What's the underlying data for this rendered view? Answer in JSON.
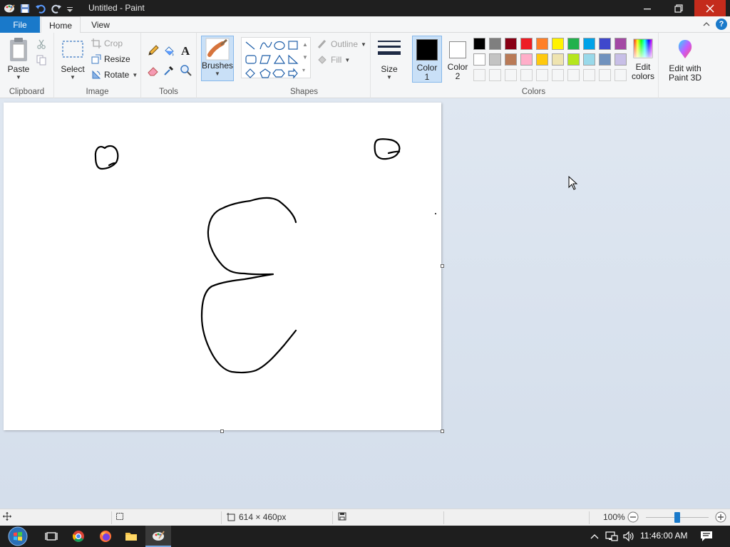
{
  "window": {
    "title": "Untitled - Paint"
  },
  "tabs": {
    "file": "File",
    "home": "Home",
    "view": "View"
  },
  "clipboard": {
    "paste": "Paste",
    "label": "Clipboard"
  },
  "image": {
    "select": "Select",
    "crop": "Crop",
    "resize": "Resize",
    "rotate": "Rotate",
    "label": "Image"
  },
  "tools": {
    "label": "Tools"
  },
  "brushes": {
    "label": "Brushes"
  },
  "shapes": {
    "outline": "Outline",
    "fill": "Fill",
    "label": "Shapes"
  },
  "size": {
    "label": "Size"
  },
  "colors": {
    "color1_label": "Color",
    "color1_num": "1",
    "color2_label": "Color",
    "color2_num": "2",
    "edit_colors_1": "Edit",
    "edit_colors_2": "colors",
    "paint3d_1": "Edit with",
    "paint3d_2": "Paint 3D",
    "label": "Colors",
    "color1_value": "#000000",
    "color2_value": "#ffffff",
    "palette_row1": [
      "#000000",
      "#7f7f7f",
      "#880015",
      "#ed1c24",
      "#ff7f27",
      "#fff200",
      "#22b14c",
      "#00a2e8",
      "#3f48cc",
      "#a349a4"
    ],
    "palette_row2": [
      "#ffffff",
      "#c3c3c3",
      "#b97a57",
      "#ffaec9",
      "#ffc90e",
      "#efe4b0",
      "#b5e61d",
      "#99d9ea",
      "#7092be",
      "#c8bfe7"
    ]
  },
  "status": {
    "dimensions": "614 × 460px",
    "zoom": "100%"
  },
  "taskbar": {
    "time": "11:46:00 AM"
  }
}
